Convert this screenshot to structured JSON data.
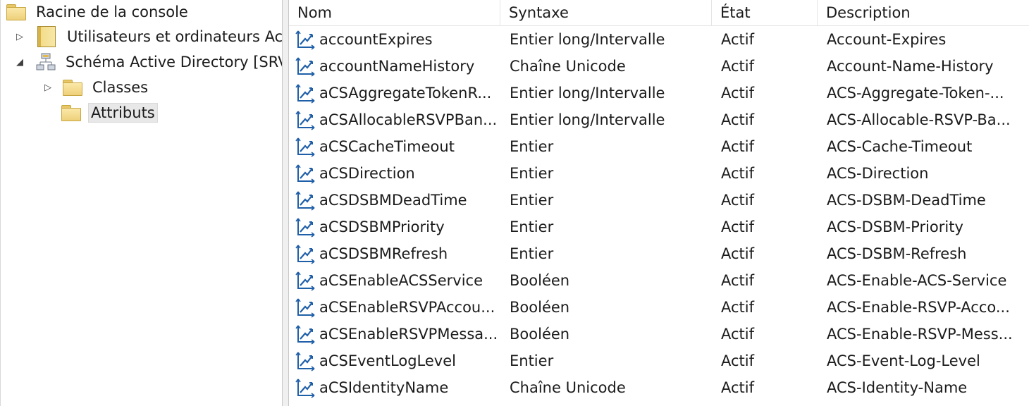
{
  "tree": {
    "root": "Racine de la console",
    "users": "Utilisateurs et ordinateurs Act",
    "schema": "Schéma Active Directory [SRV",
    "classes": "Classes",
    "attributes": "Attributs"
  },
  "list": {
    "columns": [
      "Nom",
      "Syntaxe",
      "État",
      "Description"
    ],
    "rows": [
      {
        "name": "accountExpires",
        "syntax": "Entier long/Intervalle",
        "state": "Actif",
        "description": "Account-Expires"
      },
      {
        "name": "accountNameHistory",
        "syntax": "Chaîne Unicode",
        "state": "Actif",
        "description": "Account-Name-History"
      },
      {
        "name": "aCSAggregateTokenR...",
        "syntax": "Entier long/Intervalle",
        "state": "Actif",
        "description": "ACS-Aggregate-Token-..."
      },
      {
        "name": "aCSAllocableRSVPBan...",
        "syntax": "Entier long/Intervalle",
        "state": "Actif",
        "description": "ACS-Allocable-RSVP-Ba..."
      },
      {
        "name": "aCSCacheTimeout",
        "syntax": "Entier",
        "state": "Actif",
        "description": "ACS-Cache-Timeout"
      },
      {
        "name": "aCSDirection",
        "syntax": "Entier",
        "state": "Actif",
        "description": "ACS-Direction"
      },
      {
        "name": "aCSDSBMDeadTime",
        "syntax": "Entier",
        "state": "Actif",
        "description": "ACS-DSBM-DeadTime"
      },
      {
        "name": "aCSDSBMPriority",
        "syntax": "Entier",
        "state": "Actif",
        "description": "ACS-DSBM-Priority"
      },
      {
        "name": "aCSDSBMRefresh",
        "syntax": "Entier",
        "state": "Actif",
        "description": "ACS-DSBM-Refresh"
      },
      {
        "name": "aCSEnableACSService",
        "syntax": "Booléen",
        "state": "Actif",
        "description": "ACS-Enable-ACS-Service"
      },
      {
        "name": "aCSEnableRSVPAccou...",
        "syntax": "Booléen",
        "state": "Actif",
        "description": "ACS-Enable-RSVP-Acco..."
      },
      {
        "name": "aCSEnableRSVPMessa...",
        "syntax": "Booléen",
        "state": "Actif",
        "description": "ACS-Enable-RSVP-Mess..."
      },
      {
        "name": "aCSEventLogLevel",
        "syntax": "Entier",
        "state": "Actif",
        "description": "ACS-Event-Log-Level"
      },
      {
        "name": "aCSIdentityName",
        "syntax": "Chaîne Unicode",
        "state": "Actif",
        "description": "ACS-Identity-Name"
      }
    ]
  },
  "icons": {
    "attribute": "attribute-icon",
    "folder": "folder-icon",
    "book": "book-icon",
    "schema": "schema-icon"
  },
  "colors": {
    "attribute_icon": "#1f5fa8",
    "folder": "#f2d47e",
    "selection": "#e8e8e8"
  }
}
